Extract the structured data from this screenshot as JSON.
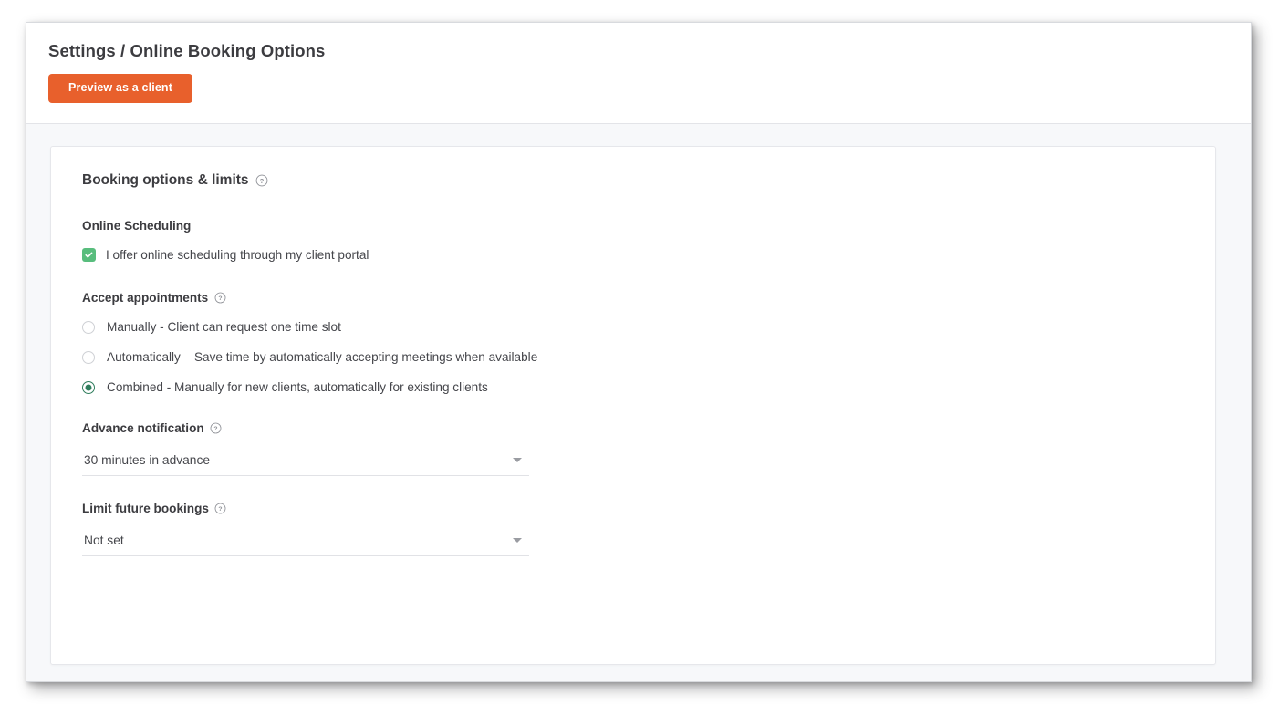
{
  "header": {
    "title": "Settings / Online Booking Options",
    "preview_button": "Preview as a client"
  },
  "card": {
    "title": "Booking options & limits",
    "online_scheduling": {
      "label": "Online Scheduling",
      "checkbox_label": "I offer online scheduling through my client portal",
      "checked": true
    },
    "accept_appointments": {
      "label": "Accept appointments",
      "options": [
        {
          "label": "Manually - Client can request one time slot",
          "selected": false
        },
        {
          "label": "Automatically – Save time by automatically accepting meetings when available",
          "selected": false
        },
        {
          "label": "Combined - Manually for new clients, automatically for existing clients",
          "selected": true
        }
      ]
    },
    "advance_notification": {
      "label": "Advance notification",
      "value": "30 minutes in advance"
    },
    "limit_future_bookings": {
      "label": "Limit future bookings",
      "value": "Not set"
    }
  },
  "icons": {
    "help": "help-circle-icon",
    "check": "check-icon",
    "caret": "chevron-down-icon"
  },
  "colors": {
    "accent_orange": "#e8602c",
    "checkbox_green": "#58bd7d",
    "radio_green": "#2f7d5c",
    "text_dark": "#3c3c40",
    "text_body": "#45464b",
    "page_bg": "#f7f8fa"
  }
}
